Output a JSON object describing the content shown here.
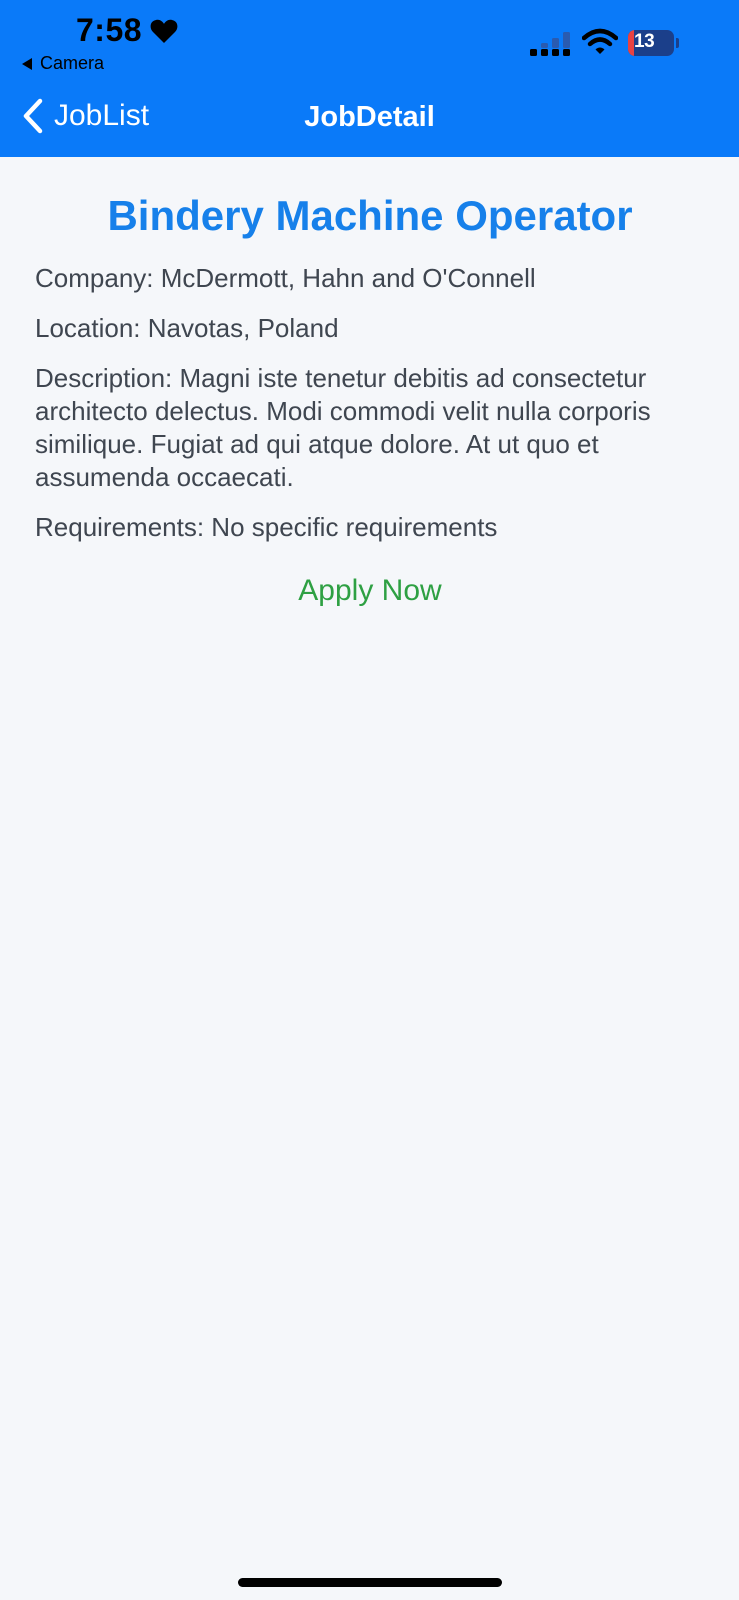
{
  "status_bar": {
    "time": "7:58",
    "back_app": "Camera",
    "battery_level": "13",
    "battery_fraction": 0.13
  },
  "nav": {
    "back_label": "JobList",
    "title": "JobDetail"
  },
  "job": {
    "title": "Bindery Machine Operator",
    "company": "Company: McDermott, Hahn and O'Connell",
    "location": "Location: Navotas, Poland",
    "description": "Description: Magni iste tenetur debitis ad consectetur architecto delectus. Modi commodi velit nulla corporis similique. Fugiat ad qui atque dolore. At ut quo et assumenda occaecati.",
    "requirements": "Requirements: No specific requirements",
    "apply_label": "Apply Now"
  },
  "colors": {
    "nav_bar": "#0a7af9",
    "title": "#1680ea",
    "apply": "#2ea043",
    "body_text": "#3f4650",
    "background": "#f5f7fa"
  },
  "icons": {
    "status": [
      "heart-icon",
      "signal-icon",
      "wifi-icon",
      "battery-icon"
    ],
    "nav": "chevron-left-icon"
  }
}
